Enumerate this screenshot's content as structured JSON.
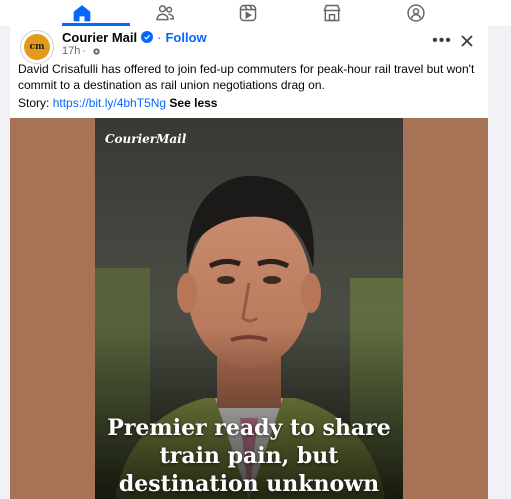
{
  "nav": {
    "items": [
      {
        "name": "home",
        "icon": "home-icon",
        "active": true
      },
      {
        "name": "friends",
        "icon": "friends-icon"
      },
      {
        "name": "video",
        "icon": "video-icon"
      },
      {
        "name": "marketplace",
        "icon": "marketplace-icon"
      },
      {
        "name": "groups",
        "icon": "groups-icon"
      }
    ],
    "accent": "#0866ff"
  },
  "post": {
    "page_name": "Courier Mail",
    "avatar_text": "cm",
    "follow_label": "Follow",
    "separator": "·",
    "time": "17h",
    "meta_sep": "·",
    "more_label": "•••",
    "text": "David Crisafulli has offered to join fed-up commuters for peak-hour rail travel but won't commit to a destination as rail union negotiations drag on.",
    "story_prefix": "Story: ",
    "story_link": "https://bit.ly/4bhT5Ng",
    "see_less": "See less"
  },
  "media": {
    "brand": "CourierMail",
    "headline_lines": [
      "Premier ready to share",
      "train pain, but",
      "destination unknown"
    ],
    "background": "#a77357"
  }
}
